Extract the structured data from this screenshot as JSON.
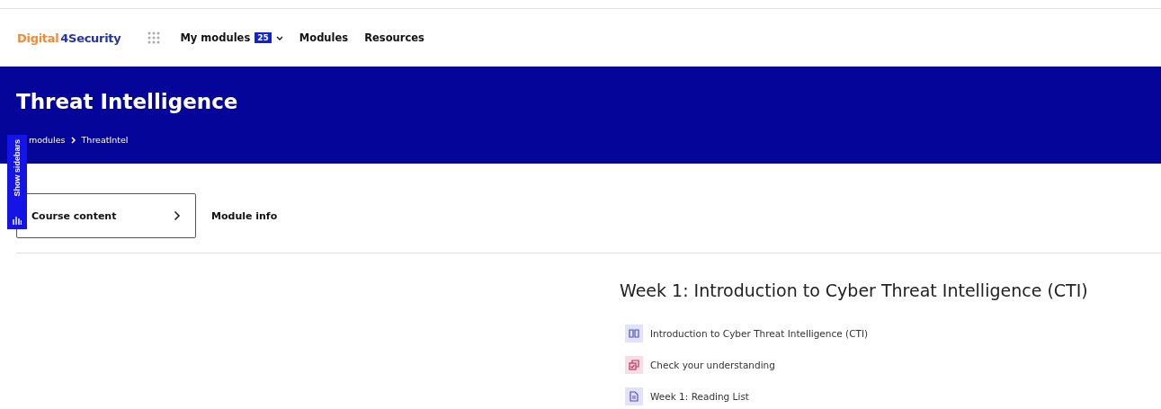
{
  "logo": {
    "part_1": "Digital",
    "part_2": "4Security"
  },
  "nav": [
    {
      "label": "My modules",
      "badge": "25",
      "dropdown": true
    },
    {
      "label": "Modules",
      "dropdown": false
    },
    {
      "label": "Resources",
      "dropdown": false
    }
  ],
  "header": {
    "title": "Threat Intelligence",
    "breadcrumb": [
      "modules",
      "ThreatIntel"
    ]
  },
  "sidebar_toggle": {
    "label": "Show sidebars"
  },
  "tabs": [
    {
      "label": "Course content",
      "selected": true
    },
    {
      "label": "Module info",
      "selected": false
    }
  ],
  "section": {
    "title": "Week 1: Introduction to Cyber Threat Intelligence (CTI)",
    "activities": [
      {
        "kind": "book",
        "label": "Introduction to Cyber Threat Intelligence (CTI)"
      },
      {
        "kind": "quiz",
        "label": "Check your understanding"
      },
      {
        "kind": "page",
        "label": "Week 1: Reading List"
      }
    ]
  }
}
